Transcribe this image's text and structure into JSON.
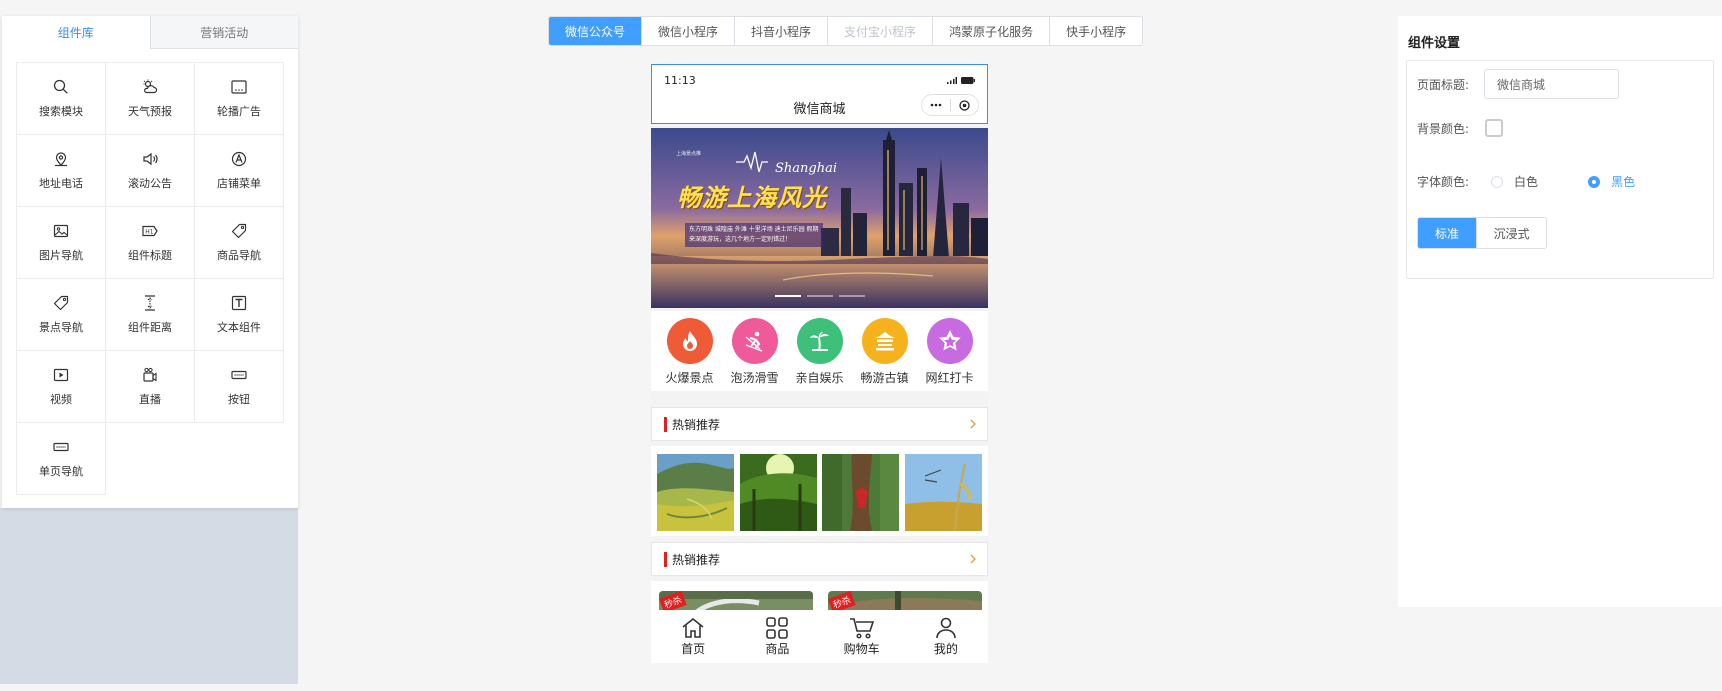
{
  "left_panel": {
    "tabs": [
      "组件库",
      "营销活动"
    ],
    "components": [
      {
        "label": "搜索模块",
        "icon": "search-icon"
      },
      {
        "label": "天气预报",
        "icon": "weather-icon"
      },
      {
        "label": "轮播广告",
        "icon": "carousel-icon"
      },
      {
        "label": "地址电话",
        "icon": "location-icon"
      },
      {
        "label": "滚动公告",
        "icon": "speaker-icon"
      },
      {
        "label": "店铺菜单",
        "icon": "store-menu-icon"
      },
      {
        "label": "图片导航",
        "icon": "image-icon"
      },
      {
        "label": "组件标题",
        "icon": "heading-icon"
      },
      {
        "label": "商品导航",
        "icon": "tag-icon"
      },
      {
        "label": "景点导航",
        "icon": "tag-icon"
      },
      {
        "label": "组件距离",
        "icon": "spacing-icon"
      },
      {
        "label": "文本组件",
        "icon": "text-icon"
      },
      {
        "label": "视频",
        "icon": "video-icon"
      },
      {
        "label": "直播",
        "icon": "live-icon"
      },
      {
        "label": "按钮",
        "icon": "button-icon"
      },
      {
        "label": "单页导航",
        "icon": "button-icon"
      }
    ]
  },
  "platform_tabs": [
    "微信公众号",
    "微信小程序",
    "抖音小程序",
    "支付宝小程序",
    "鸿蒙原子化服务",
    "快手小程序"
  ],
  "phone": {
    "time": "11:13",
    "title": "微信商城",
    "banner": {
      "small": "上海景点推",
      "en": "Shanghai",
      "cn": "畅游上海风光",
      "desc": "东方明珠 城隍庙 外滩 十里洋场 迪士尼乐园 假期来深度游玩，这几个地方一定别错过！"
    },
    "categories": [
      {
        "label": "火爆景点",
        "icon": "flame-icon",
        "color": "#ef5a37"
      },
      {
        "label": "泡汤滑雪",
        "icon": "skier-icon",
        "color": "#ef5b9a"
      },
      {
        "label": "亲自娱乐",
        "icon": "palm-tree-icon",
        "color": "#3ec07a"
      },
      {
        "label": "畅游古镇",
        "icon": "pavilion-icon",
        "color": "#f5b21c"
      },
      {
        "label": "网红打卡",
        "icon": "star-icon",
        "color": "#c86ae0"
      }
    ],
    "section1": "热销推荐",
    "section2": "热销推荐",
    "product_tags": [
      "秒杀",
      "秒杀"
    ],
    "tabbar": [
      {
        "label": "首页",
        "icon": "home-icon"
      },
      {
        "label": "商品",
        "icon": "grid-icon"
      },
      {
        "label": "购物车",
        "icon": "cart-icon"
      },
      {
        "label": "我的",
        "icon": "user-icon"
      }
    ]
  },
  "settings": {
    "title": "组件设置",
    "page_title_label": "页面标题:",
    "page_title_value": "微信商城",
    "bg_color_label": "背景颜色:",
    "font_color_label": "字体颜色:",
    "font_color_options": [
      "白色",
      "黑色"
    ],
    "mode_options": [
      "标准",
      "沉浸式"
    ]
  },
  "colors": {
    "accent": "#409eff",
    "danger": "#e02020"
  }
}
